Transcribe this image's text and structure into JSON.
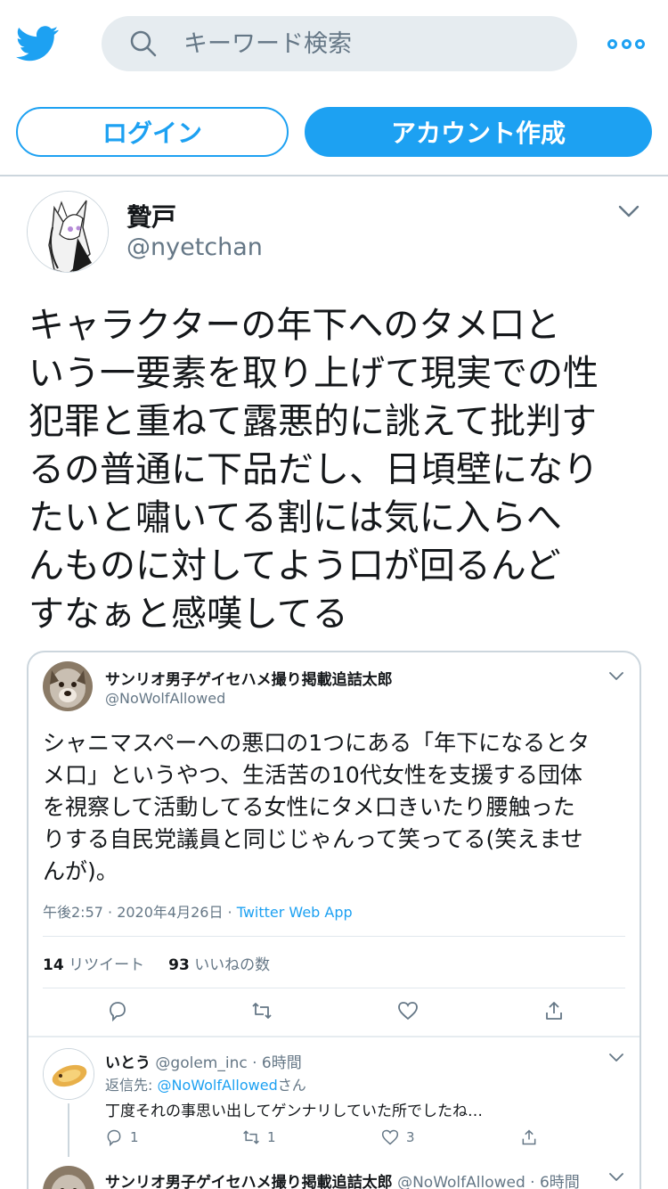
{
  "header": {
    "search_placeholder": "キーワード検索",
    "login_label": "ログイン",
    "signup_label": "アカウント作成"
  },
  "tweet": {
    "name": "贄戸",
    "handle": "@nyetchan",
    "text_lines": [
      "キャラクターの年下へのタメ口と",
      "いう一要素を取り上げて現実での性",
      "犯罪と重ねて露悪的に誂えて批判す",
      "るの普通に下品だし、日頃壁になり",
      "たいと嘯いてる割には気に入らへ",
      "んものに対してよう口が回るんど",
      "すなぁと感嘆してる"
    ]
  },
  "quoted": {
    "name": "サンリオ男子ゲイセハメ撮り掲載追詰太郎",
    "handle": "@NoWolfAllowed",
    "text_lines": [
      "シャニマスペーへの悪口の1つにある「年下になるとタ",
      "メ口」というやつ、生活苦の10代女性を支援する団体",
      "を視察して活動してる女性にタメ口きいたり腰触った",
      "りする自民党議員と同じじゃんって笑ってる(笑えませ",
      "んが)。"
    ],
    "time": "午後2:57 · 2020年4月26日 ·",
    "source": "Twitter Web App",
    "retweet_count": "14",
    "retweet_label": "リツイート",
    "like_count": "93",
    "like_label": "いいねの数"
  },
  "reply1": {
    "name": "いとう",
    "handle": "@golem_inc",
    "age": "· 6時間",
    "reply_prefix": "返信先:",
    "reply_to": "@NoWolfAllowed",
    "reply_suffix": "さん",
    "text": "丁度それの事思い出してゲンナリしていた所でしたね…",
    "reply_count": "1",
    "retweet_count": "1",
    "like_count": "3"
  },
  "reply2": {
    "name": "サンリオ男子ゲイセハメ撮り掲載追詰太郎",
    "handle": "@NoWolfAllowed",
    "age": "· 6時間"
  },
  "colors": {
    "accent": "#1da1f2",
    "text": "#14171a",
    "secondary": "#657786",
    "search_bg": "#e6ecf0",
    "border": "#ccd6dd"
  }
}
